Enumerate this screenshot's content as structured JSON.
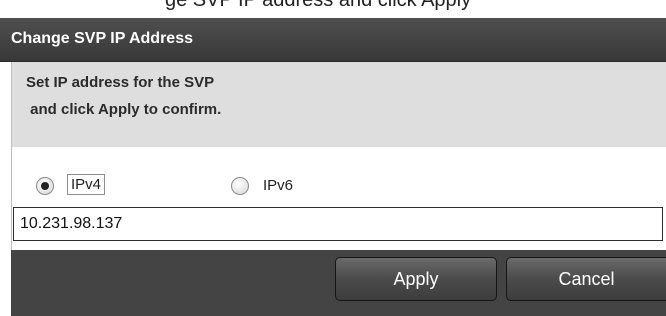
{
  "background_partial_text": "ge SVP IP address and click Apply",
  "dialog": {
    "title": "Change SVP IP Address",
    "instructions": {
      "line1": "Set IP address for the SVP",
      "line2": " and click Apply to confirm."
    },
    "ip_version": {
      "options": [
        {
          "label": "IPv4",
          "selected": true
        },
        {
          "label": "IPv6",
          "selected": false
        }
      ]
    },
    "ip_address": {
      "value": "10.231.98.137"
    },
    "buttons": {
      "apply_label": "Apply",
      "cancel_label": "Cancel"
    }
  },
  "colors": {
    "titlebar": "#444444",
    "instructions_bg": "#dedede",
    "footer": "#444444",
    "button": "#4b4b4b"
  }
}
